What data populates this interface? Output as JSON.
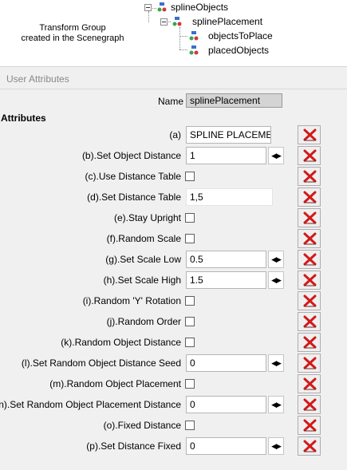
{
  "scenegraph": {
    "caption_line1": "Transform Group",
    "caption_line2": "created in the Scenegraph",
    "nodes": [
      {
        "label": "splineObjects"
      },
      {
        "label": "splinePlacement"
      },
      {
        "label": "objectsToPlace"
      },
      {
        "label": "placedObjects"
      }
    ]
  },
  "panel": {
    "title": "User Attributes",
    "name_label": "Name",
    "name_value": "splinePlacement",
    "attributes_heading": "Attributes"
  },
  "attributes": [
    {
      "label": "(a)",
      "type": "text",
      "value": "SPLINE PLACEMEN"
    },
    {
      "label": "(b).Set Object Distance",
      "type": "number",
      "value": "1"
    },
    {
      "label": "(c).Use Distance Table",
      "type": "checkbox",
      "checked": false
    },
    {
      "label": "(d).Set Distance Table",
      "type": "text",
      "value": "1,5"
    },
    {
      "label": "(e).Stay Upright",
      "type": "checkbox",
      "checked": false
    },
    {
      "label": "(f).Random Scale",
      "type": "checkbox",
      "checked": false
    },
    {
      "label": "(g).Set Scale Low",
      "type": "number",
      "value": "0.5"
    },
    {
      "label": "(h).Set Scale High",
      "type": "number",
      "value": "1.5"
    },
    {
      "label": "(i).Random 'Y' Rotation",
      "type": "checkbox",
      "checked": false
    },
    {
      "label": "(j).Random Order",
      "type": "checkbox",
      "checked": false
    },
    {
      "label": "(k).Random Object Distance",
      "type": "checkbox",
      "checked": false
    },
    {
      "label": "(l).Set Random Object Distance Seed",
      "type": "number",
      "value": "0"
    },
    {
      "label": "(m).Random Object Placement",
      "type": "checkbox",
      "checked": false
    },
    {
      "label": "(n).Set Random Object Placement Distance",
      "type": "number",
      "value": "0"
    },
    {
      "label": "(o).Fixed Distance",
      "type": "checkbox",
      "checked": false
    },
    {
      "label": "(p).Set Distance Fixed",
      "type": "number",
      "value": "0"
    }
  ],
  "icons": {
    "stepper": "left-right-arrows-icon",
    "delete": "red-x-delete-icon",
    "node": "transform-group-node-icon"
  },
  "colors": {
    "panel_bg": "#f0f0f0",
    "delete_red": "#d21a1a",
    "name_field_bg": "#d4d4d4"
  }
}
